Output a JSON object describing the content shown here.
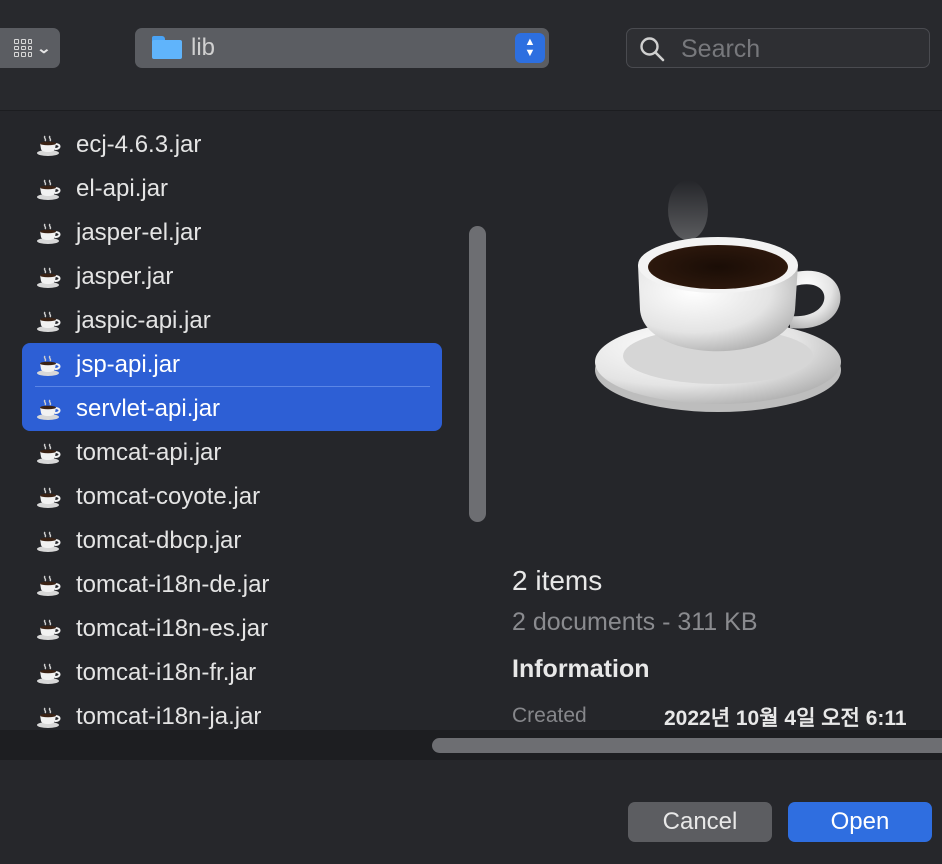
{
  "toolbar": {
    "view_icons": [
      "grid-icon",
      "chevron-down-icon"
    ],
    "path": "lib",
    "search_placeholder": "Search"
  },
  "files": [
    {
      "name": "ecj-4.6.3.jar",
      "selected": false
    },
    {
      "name": "el-api.jar",
      "selected": false
    },
    {
      "name": "jasper-el.jar",
      "selected": false
    },
    {
      "name": "jasper.jar",
      "selected": false
    },
    {
      "name": "jaspic-api.jar",
      "selected": false
    },
    {
      "name": "jsp-api.jar",
      "selected": true
    },
    {
      "name": "servlet-api.jar",
      "selected": true
    },
    {
      "name": "tomcat-api.jar",
      "selected": false
    },
    {
      "name": "tomcat-coyote.jar",
      "selected": false
    },
    {
      "name": "tomcat-dbcp.jar",
      "selected": false
    },
    {
      "name": "tomcat-i18n-de.jar",
      "selected": false
    },
    {
      "name": "tomcat-i18n-es.jar",
      "selected": false
    },
    {
      "name": "tomcat-i18n-fr.jar",
      "selected": false
    },
    {
      "name": "tomcat-i18n-ja.jar",
      "selected": false
    }
  ],
  "info": {
    "count": "2 items",
    "summary": "2 documents - 311 KB",
    "heading": "Information",
    "created_label": "Created",
    "created_value": "2022년 10월 4일 오전 6:11"
  },
  "buttons": {
    "cancel": "Cancel",
    "open": "Open"
  },
  "colors": {
    "accent": "#2f6ee0",
    "selection": "#2d5fd5",
    "background": "#25262a"
  }
}
